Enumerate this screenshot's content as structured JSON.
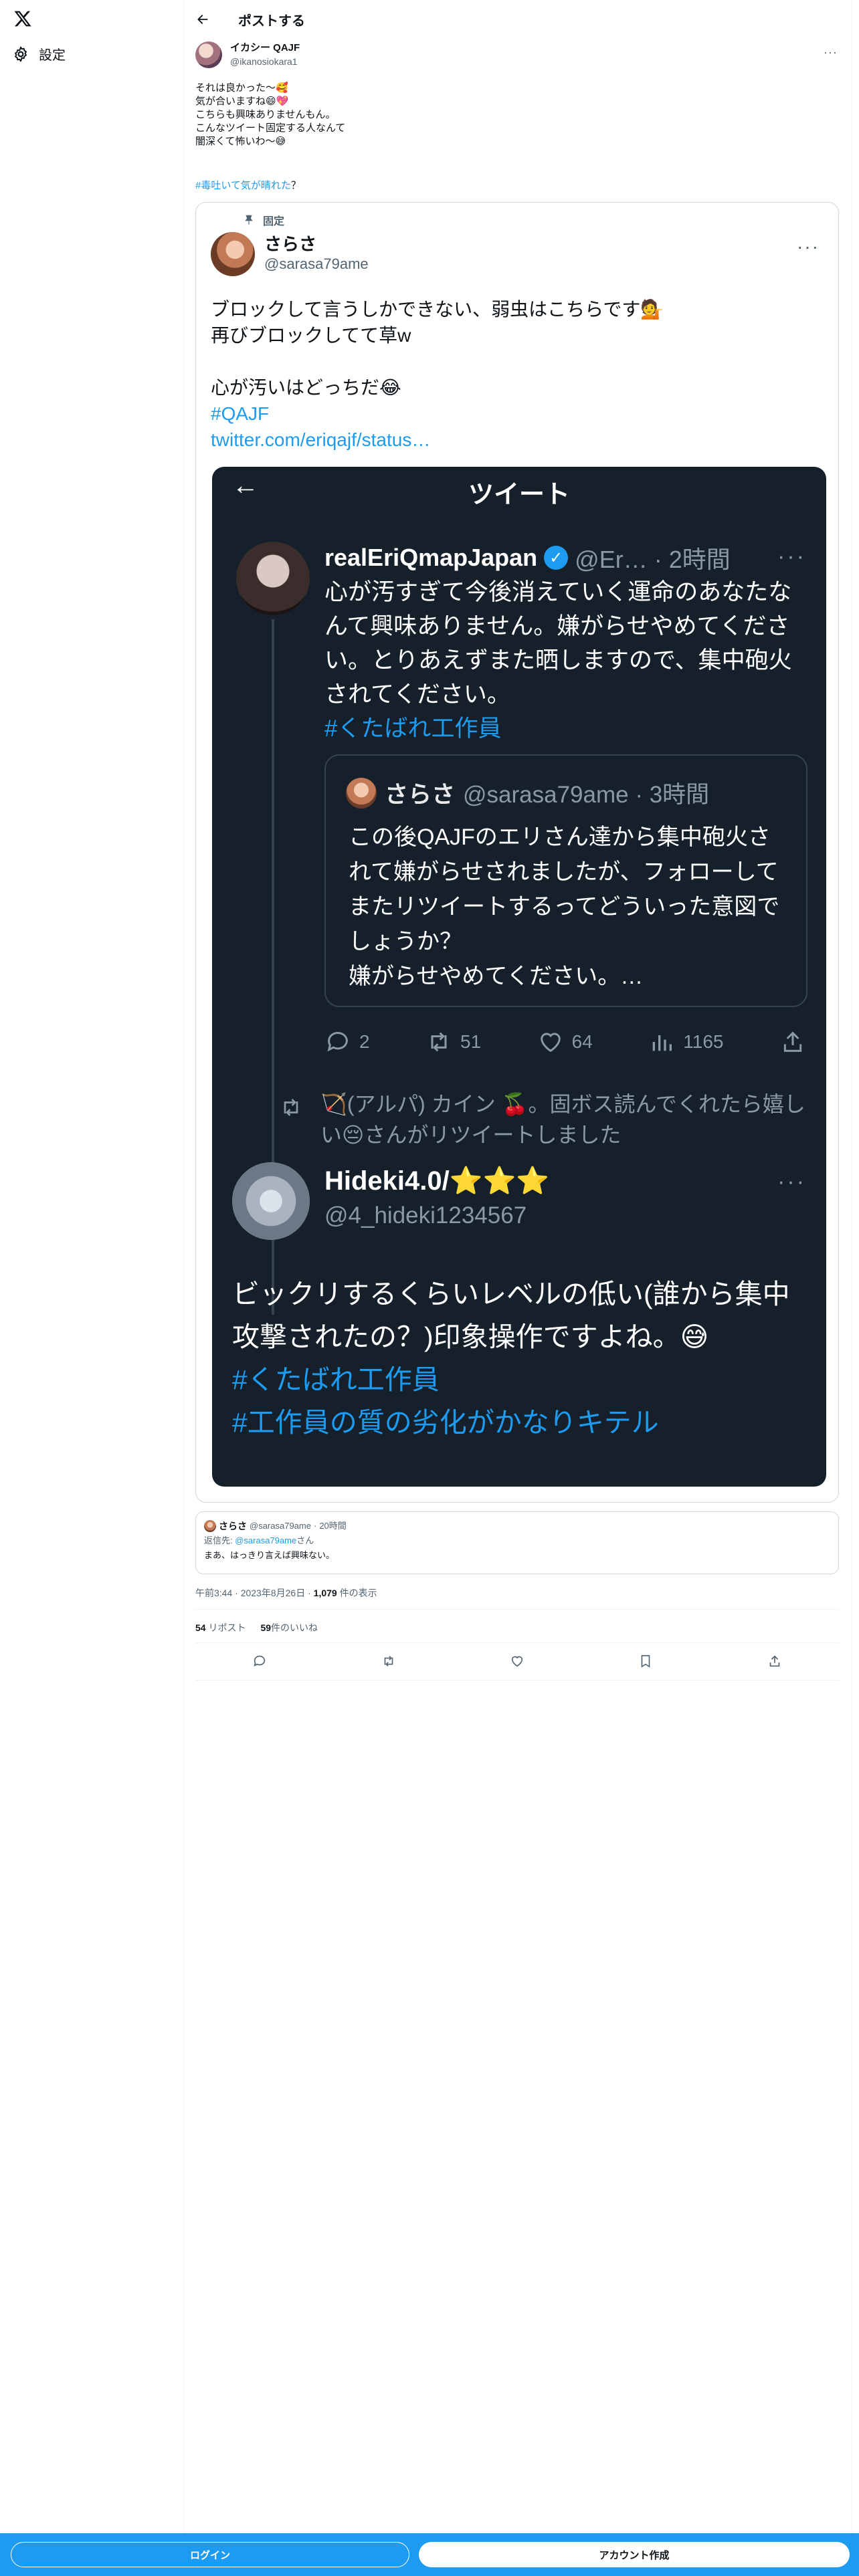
{
  "nav": {
    "settings_label": "設定"
  },
  "header": {
    "title": "ポストする"
  },
  "tweet": {
    "author_name": "イカシー QAJF",
    "author_handle": "@ikanosiokara1",
    "text": "それは良かった〜🥰\n気が合いますね😄💖\nこちらも興味ありませんもん。\nこんなツイート固定する人なんて\n闇深くて怖いわ〜😅",
    "hashtag": "#毒吐いて気が晴れた",
    "hashtag_suffix": "？"
  },
  "quote": {
    "pinned_label": "固定",
    "author_name": "さらさ",
    "author_handle": "@sarasa79ame",
    "line1": "ブロックして言うしかできない、弱虫はこちらです💁",
    "line2": "再びブロックしてて草w",
    "line3": "心が汚いはどっちだ😂",
    "hashtag": "#QAJF",
    "link": "twitter.com/eriqajf/status…"
  },
  "shot": {
    "title": "ツイート",
    "t1_name": "realEriQmapJapan",
    "t1_meta": "@Er… · 2時間",
    "t1_text": "心が汚すぎて今後消えていく運命のあなたなんて興味ありません。嫌がらせやめてください。とりあえずまた晒しますので、集中砲火されてください。",
    "t1_tag": "#くたばれ工作員",
    "inner_name": "さらさ",
    "inner_meta": "@sarasa79ame · 3時間",
    "inner_text": "この後QAJFのエリさん達から集中砲火されて嫌がらせされましたが、フォローしてまたリツイートするってどういった意図でしょうか？\n嫌がらせやめてください。…",
    "replies": "2",
    "retweets": "51",
    "likes": "64",
    "views": "1165",
    "rt_text": "🏹(アルパ) カイン 🍒。固ボス読んでくれたら嬉しい😔さんがリツイートしました",
    "t2_name": "Hideki4.0/⭐⭐⭐",
    "t2_handle": "@4_hideki1234567",
    "t2_text": "ビックリするくらいレベルの低い(誰から集中攻撃されたの？)印象操作ですよね。😅",
    "t2_tag1": "#くたばれ工作員",
    "t2_tag2": "#工作員の質の劣化がかなりキテル"
  },
  "reply": {
    "name": "さらさ",
    "handle": "@sarasa79ame",
    "time": "20時間",
    "reply_to_label": "返信先: ",
    "reply_to_handle": "@sarasa79ame",
    "reply_to_suffix": "さん",
    "text": "まあ、はっきり言えば興味ない。"
  },
  "meta": {
    "time": "午前3:44",
    "date": "2023年8月26日",
    "views_count": "1,079",
    "views_label": "件の表示"
  },
  "stats": {
    "reposts_count": "54",
    "reposts_label": "リポスト",
    "likes_count": "59",
    "likes_label": "件のいいね"
  },
  "bottom": {
    "login": "ログイン",
    "signup": "アカウント作成"
  },
  "colors": {
    "accent": "#1d9bf0",
    "dark_bg": "#15202b"
  }
}
